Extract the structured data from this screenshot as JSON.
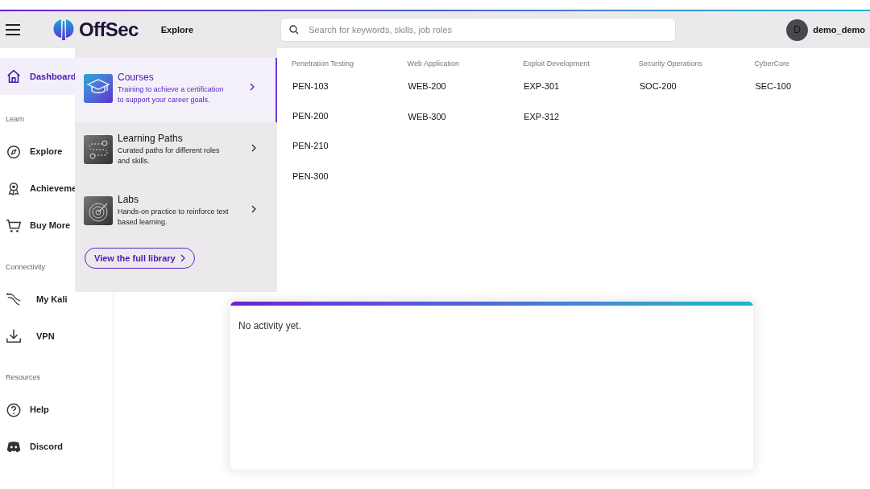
{
  "header": {
    "brand": "OffSec",
    "nav": "Explore",
    "search": {
      "placeholder": "Search for keywords, skills, job roles"
    },
    "user": {
      "initial": "D",
      "name": "demo_demo"
    }
  },
  "sidebar": {
    "sections": [
      {
        "items": [
          {
            "label": "Dashboard",
            "selected": true
          }
        ]
      },
      {
        "heading": "Learn",
        "items": [
          {
            "label": "Explore",
            "selected": false
          },
          {
            "label": "Achieveme",
            "selected": false
          },
          {
            "label": "Buy More",
            "selected": false
          }
        ]
      },
      {
        "heading": "Connectivity",
        "items": [
          {
            "label": "My Kali",
            "selected": false
          },
          {
            "label": "VPN",
            "selected": false
          }
        ]
      },
      {
        "heading": "Resources",
        "items": [
          {
            "label": "Help",
            "selected": false
          },
          {
            "label": "Discord",
            "selected": false
          }
        ]
      }
    ]
  },
  "explore_menu": {
    "categories": [
      {
        "title": "Courses",
        "description": "Training to achieve a certification to support your career goals.",
        "selected": true
      },
      {
        "title": "Learning Paths",
        "description": "Curated paths for different roles and skills.",
        "selected": false
      },
      {
        "title": "Labs",
        "description": "Hands-on practice to reinforce text based learning.",
        "selected": false
      }
    ],
    "library_link": "View the full library",
    "columns": [
      {
        "heading": "Penetration Testing",
        "courses": [
          "PEN-103",
          "PEN-200",
          "PEN-210",
          "PEN-300"
        ]
      },
      {
        "heading": "Web Application",
        "courses": [
          "WEB-200",
          "WEB-300"
        ]
      },
      {
        "heading": "Exploit Development",
        "courses": [
          "EXP-301",
          "EXP-312"
        ]
      },
      {
        "heading": "Security Operations",
        "courses": [
          "SOC-200"
        ]
      },
      {
        "heading": "CyberCore",
        "courses": [
          "SEC-100"
        ]
      }
    ]
  },
  "learning_activity": {
    "empty_text": "No activity yet."
  }
}
